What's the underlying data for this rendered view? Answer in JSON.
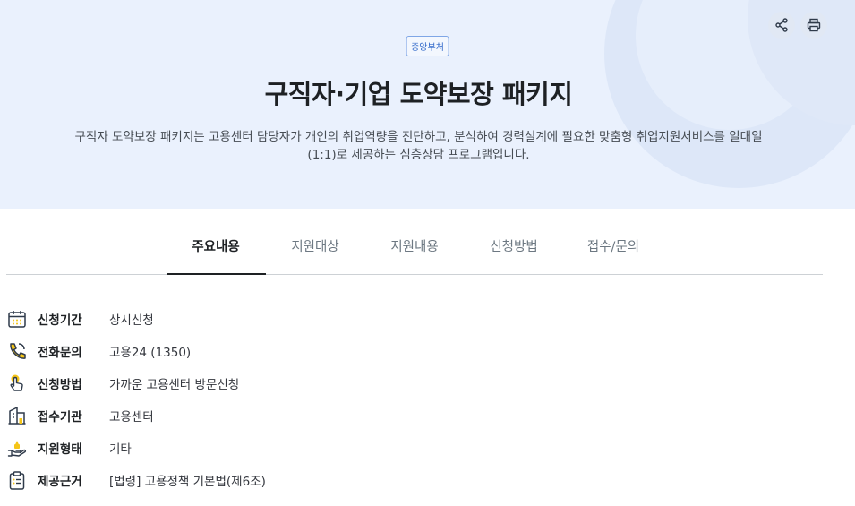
{
  "header": {
    "badge": "중앙부처",
    "title": "구직자·기업 도약보장 패키지",
    "description": "구직자 도약보장 패키지는 고용센터 담당자가 개인의 취업역량을 진단하고, 분석하여 경력설계에 필요한 맞춤형 취업지원서비스를 일대일(1:1)로 제공하는 심층상담 프로그램입니다.",
    "actions": [
      {
        "name": "share-button",
        "icon": "share-icon"
      },
      {
        "name": "print-button",
        "icon": "printer-icon"
      }
    ]
  },
  "tabs": [
    {
      "label": "주요내용",
      "active": true
    },
    {
      "label": "지원대상",
      "active": false
    },
    {
      "label": "지원내용",
      "active": false
    },
    {
      "label": "신청방법",
      "active": false
    },
    {
      "label": "접수/문의",
      "active": false
    }
  ],
  "info": [
    {
      "label": "신청기간",
      "value": "상시신청",
      "icon": "calendar-icon"
    },
    {
      "label": "전화문의",
      "value": "고용24 (1350)",
      "icon": "phone-icon"
    },
    {
      "label": "신청방법",
      "value": "가까운 고용센터 방문신청",
      "icon": "hand-pointer-icon"
    },
    {
      "label": "접수기관",
      "value": "고용센터",
      "icon": "building-icon"
    },
    {
      "label": "지원형태",
      "value": "기타",
      "icon": "hand-support-icon"
    },
    {
      "label": "제공근거",
      "value": "[법령] 고용정책 기본법(제6조)",
      "icon": "clipboard-icon"
    }
  ],
  "colors": {
    "hero_bg": "#eaf1fd",
    "badge_accent": "#2f67c9",
    "icon_accent": "#f5c518",
    "icon_stroke": "#2f3a4a"
  }
}
